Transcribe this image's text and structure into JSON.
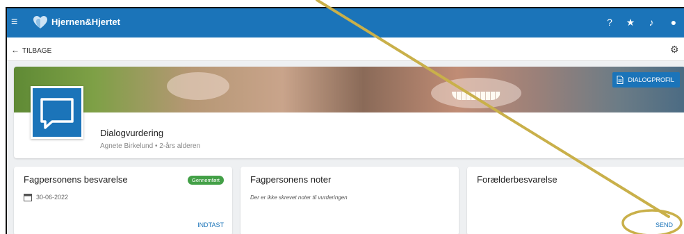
{
  "appbar": {
    "brand": "Hjernen&Hjertet",
    "menu_icon": "menu-icon",
    "actions": [
      "help-icon",
      "star-icon",
      "bell-icon",
      "account-icon"
    ],
    "glyphs": {
      "menu": "≡",
      "help": "?",
      "star": "★",
      "bell": "♪",
      "account": "●"
    }
  },
  "subbar": {
    "back_label": "TILBAGE",
    "back_glyph": "←",
    "gear_glyph": "⚙"
  },
  "header": {
    "title": "Dialogvurdering",
    "subtitle": "Agnete Birkelund • 2-års alderen",
    "profile_button": "DIALOGPROFIL"
  },
  "cards": [
    {
      "title": "Fagpersonens besvarelse",
      "badge": "Gennemført",
      "date": "30-06-2022",
      "action": "INDTAST"
    },
    {
      "title": "Fagpersonens noter",
      "note": "Der er ikke skrevet noter til vurderingen"
    },
    {
      "title": "Forælderbesvarelse",
      "action": "SEND"
    }
  ],
  "colors": {
    "primary": "#1b74b9",
    "success": "#43a047",
    "annotation": "#c9b04a"
  }
}
